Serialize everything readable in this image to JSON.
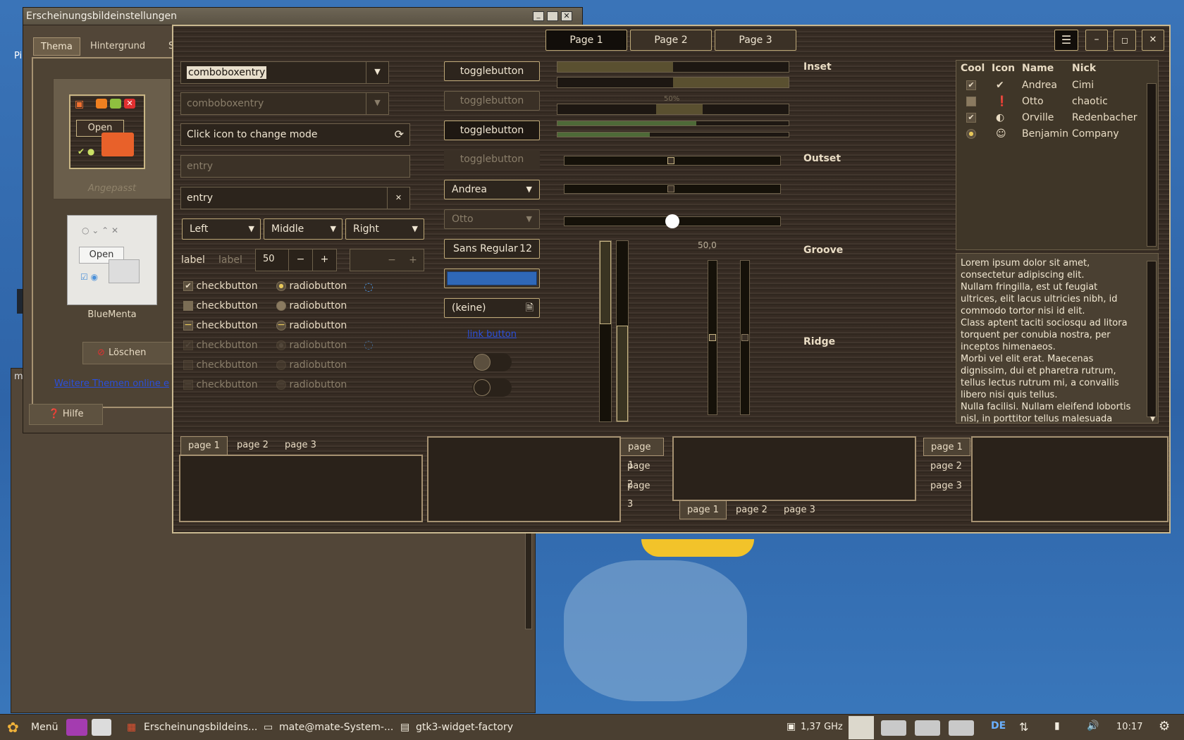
{
  "desktop": {
    "left_char": "Pi",
    "win2_char": "m"
  },
  "theme_window": {
    "title": "Erscheinungsbildeinstellungen",
    "tabs": [
      "Thema",
      "Hintergrund",
      "S"
    ],
    "themes": [
      {
        "name": "Angepasst",
        "preview_button": "Open"
      },
      {
        "name": "BlueMenta",
        "preview_button": "Open"
      }
    ],
    "delete_button": "Löschen",
    "more_themes_link": "Weitere Themen online e",
    "help_button": "Hilfe"
  },
  "factory": {
    "tabs": [
      "Page 1",
      "Page 2",
      "Page 3"
    ],
    "combo_entry": {
      "value": "comboboxentry",
      "disabled_value": "comboboxentry"
    },
    "icon_entry_placeholder": "Click icon to change mode",
    "entry_disabled": "entry",
    "entry_value": "entry",
    "combos": [
      "Left",
      "Middle",
      "Right"
    ],
    "label_active": "label",
    "label_inactive": "label",
    "spin_value": "50",
    "checks": [
      "checkbutton",
      "checkbutton",
      "checkbutton",
      "checkbutton",
      "checkbutton",
      "checkbutton"
    ],
    "radios": [
      "radiobutton",
      "radiobutton",
      "radiobutton",
      "radiobutton",
      "radiobutton",
      "radiobutton"
    ],
    "toggles": [
      "togglebutton",
      "togglebutton",
      "togglebutton",
      "togglebutton"
    ],
    "combo_andrea": "Andrea",
    "combo_otto": "Otto",
    "font_button": {
      "name": "Sans Regular",
      "size": "12"
    },
    "file_button": "(keine)",
    "link_button": "link button",
    "progress_label": "50%",
    "scale_value": "50,0",
    "frames": [
      "Inset",
      "Outset",
      "Groove",
      "Ridge"
    ],
    "tree": {
      "headers": [
        "Cool",
        "Icon",
        "Name",
        "Nick"
      ],
      "rows": [
        {
          "cool": "checked",
          "icon": "check-circle-icon",
          "name": "Andrea",
          "nick": "Cimi"
        },
        {
          "cool": "unchecked",
          "icon": "warning-icon",
          "name": "Otto",
          "nick": "chaotic"
        },
        {
          "cool": "checked",
          "icon": "moon-icon",
          "name": "Orville",
          "nick": "Redenbacher"
        },
        {
          "cool": "radio",
          "icon": "person-icon",
          "name": "Benjamin",
          "nick": "Company"
        }
      ]
    },
    "text_lines": [
      "Lorem ipsum dolor sit amet,",
      "consectetur adipiscing elit.",
      "Nullam fringilla, est ut feugiat",
      "ultrices, elit lacus ultricies nibh, id",
      "commodo tortor nisi id elit.",
      "Class aptent taciti sociosqu ad litora",
      "torquent per conubia nostra, per",
      "inceptos himenaeos.",
      "Morbi vel elit erat. Maecenas",
      "dignissim, dui et pharetra rutrum,",
      "tellus lectus rutrum mi, a convallis",
      "libero nisi quis tellus.",
      "Nulla facilisi. Nullam eleifend lobortis",
      "nisl, in porttitor tellus malesuada"
    ],
    "notebook_tabs": [
      "page 1",
      "page 2",
      "page 3"
    ]
  },
  "taskbar": {
    "menu": "Menü",
    "tasks": [
      "Erscheinungsbildeins...",
      "mate@mate-System-...",
      "gtk3-widget-factory"
    ],
    "cpu": "1,37 GHz",
    "kbd": "DE",
    "clock": "10:17"
  }
}
